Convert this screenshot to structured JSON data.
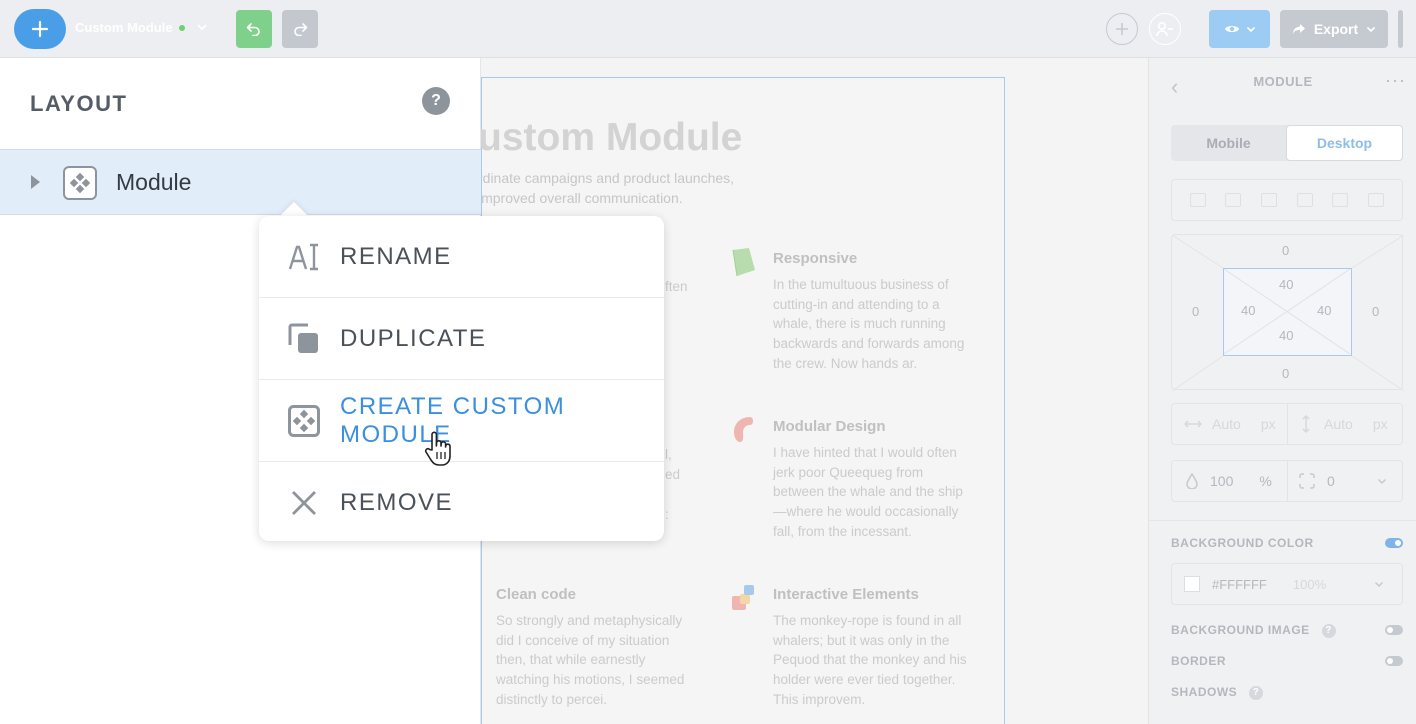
{
  "toolbar": {
    "module_name": "Custom Module",
    "export_label": "Export"
  },
  "layout_panel": {
    "title": "LAYOUT",
    "help": "?",
    "module_label": "Module"
  },
  "context_menu": {
    "items": [
      {
        "label": "RENAME",
        "icon": "rename-icon"
      },
      {
        "label": "DUPLICATE",
        "icon": "duplicate-icon"
      },
      {
        "label": "CREATE CUSTOM MODULE",
        "icon": "module-icon",
        "active": true
      },
      {
        "label": "REMOVE",
        "icon": "close-icon"
      }
    ]
  },
  "canvas": {
    "title": "ustom Module",
    "subtitle_line1": "rdinate campaigns and product launches,",
    "subtitle_line2": "improved overall communication.",
    "clipped_fragments": [
      "ften",
      "l,",
      "ed",
      ":"
    ],
    "features": [
      {
        "title": "Responsive",
        "text": "In the tumultuous business of cutting-in and attending to a whale, there is much running backwards and forwards among the crew. Now hands ar."
      },
      {
        "title": "Modular Design",
        "text": "I have hinted that I would often jerk poor Queequeg from between the whale and the ship—where he would occasionally fall, from the incessant."
      },
      {
        "title": "Clean code",
        "text": "So strongly and metaphysically did I conceive of my situation then, that while earnestly watching his motions, I seemed distinctly to percei."
      },
      {
        "title": "Interactive Elements",
        "text": "The monkey-rope is found in all whalers; but it was only in the Pequod that the monkey and his holder were ever tied together. This improvem."
      }
    ]
  },
  "props": {
    "title": "MODULE",
    "more": "···",
    "tab_mobile": "Mobile",
    "tab_desktop": "Desktop",
    "margin": {
      "top": "0",
      "right": "0",
      "bottom": "0",
      "left": "0"
    },
    "padding": {
      "top": "40",
      "right": "40",
      "bottom": "40",
      "left": "40"
    },
    "width_placeholder": "Auto",
    "width_unit": "px",
    "height_placeholder": "Auto",
    "height_unit": "px",
    "opacity": "100",
    "opacity_unit": "%",
    "radius": "0",
    "background_color_label": "BACKGROUND COLOR",
    "background_color_value": "#FFFFFF",
    "background_color_opacity": "100%",
    "background_image_label": "BACKGROUND IMAGE",
    "border_label": "BORDER",
    "shadows_label": "SHADOWS"
  },
  "colors": {
    "accent": "#3a8fe0",
    "selected_row": "#e2edfa"
  }
}
